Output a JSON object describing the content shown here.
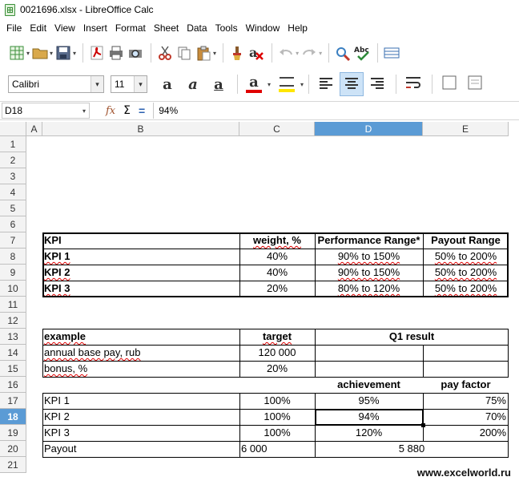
{
  "window": {
    "title": "0021696.xlsx - LibreOffice Calc"
  },
  "menu": [
    "File",
    "Edit",
    "View",
    "Insert",
    "Format",
    "Sheet",
    "Data",
    "Tools",
    "Window",
    "Help"
  ],
  "font": {
    "name": "Calibri",
    "size": "11"
  },
  "namebox": "D18",
  "formula": "94%",
  "columns": [
    "A",
    "B",
    "C",
    "D",
    "E"
  ],
  "rows": [
    "1",
    "2",
    "3",
    "4",
    "5",
    "6",
    "7",
    "8",
    "9",
    "10",
    "11",
    "12",
    "13",
    "14",
    "15",
    "16",
    "17",
    "18",
    "19",
    "20",
    "21"
  ],
  "selected": {
    "col": "D",
    "row": "18"
  },
  "kpi_table": {
    "headers": [
      "KPI",
      "weight, %",
      "Performance Range*",
      "Payout Range"
    ],
    "rows": [
      [
        "KPI 1",
        "40%",
        "90% to 150%",
        "50% to 200%"
      ],
      [
        "KPI 2",
        "40%",
        "90% to 150%",
        "50% to 200%"
      ],
      [
        "KPI 3",
        "20%",
        "80% to 120%",
        "50% to 200%"
      ]
    ]
  },
  "example": {
    "label": "example",
    "target": "target",
    "q1": "Q1 result",
    "base_pay_label": "annual base pay, rub",
    "base_pay": "120 000",
    "bonus_label": "bonus, %",
    "bonus": "20%",
    "achievement": "achievement",
    "pay_factor": "pay factor",
    "kpis": [
      [
        "KPI 1",
        "100%",
        "95%",
        "75%"
      ],
      [
        "KPI 2",
        "100%",
        "94%",
        "70%"
      ],
      [
        "KPI 3",
        "100%",
        "120%",
        "200%"
      ]
    ],
    "payout_label": "Payout",
    "payout_target": "6 000",
    "payout_result": "5 880"
  },
  "watermark": "www.excelworld.ru",
  "colors": {
    "selection": "#5b9bd5"
  }
}
